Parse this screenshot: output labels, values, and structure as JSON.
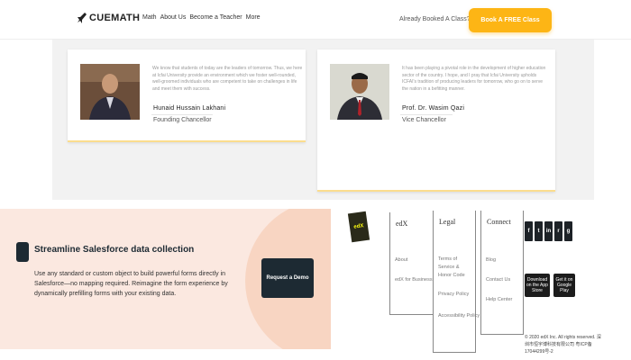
{
  "nav": {
    "logo": "CUEMATH",
    "links": [
      "Math",
      "About Us",
      "Become a Teacher",
      "More"
    ],
    "already_booked": "Already Booked A Class?",
    "cta": "Book A FREE Class"
  },
  "testimonials": [
    {
      "quote": "We know that students of today are the leaders of tomorrow. Thus, we here at Icfai University provide an environment which we foster well-rounded, well-groomed individuals who are competent to take on challenges in life and meet them with success.",
      "name": "Hunaid Hussain Lakhani",
      "role": "Founding Chancellor"
    },
    {
      "quote": "It has been playing a pivotal role in the development of higher education sector of the country. I hope, and I pray that Icfai University upholds ICFAI's tradition of producing leaders for tomorrow, who go on to serve the nation in a befitting manner.",
      "name": "Prof. Dr. Wasim Qazi",
      "role": "Vice Chancellor"
    }
  ],
  "banner": {
    "title": "Streamline Salesforce data collection",
    "description": "Use any standard or custom object to build powerful forms directly in Salesforce—no mapping required. Reimagine the form experience by dynamically prefilling forms with your existing data.",
    "button": "Request a Demo"
  },
  "footer": {
    "logo": "edX",
    "columns": [
      {
        "heading": "edX",
        "links": [
          "About",
          "edX for Business"
        ]
      },
      {
        "heading": "Legal",
        "links": [
          "Terms of Service & Honor Code",
          "Privacy Policy",
          "Accessibility Policy"
        ]
      },
      {
        "heading": "Connect",
        "links": [
          "Blog",
          "Contact Us",
          "Help Center"
        ]
      }
    ],
    "social": [
      "f",
      "t",
      "in",
      "r",
      "g"
    ],
    "stores": [
      "Download on the App Store",
      "Get it on Google Play"
    ],
    "copyright": "© 2020 edX Inc. All rights reserved. 深圳市恒宇博科技有限公司 粤ICP备17044299号-2"
  }
}
